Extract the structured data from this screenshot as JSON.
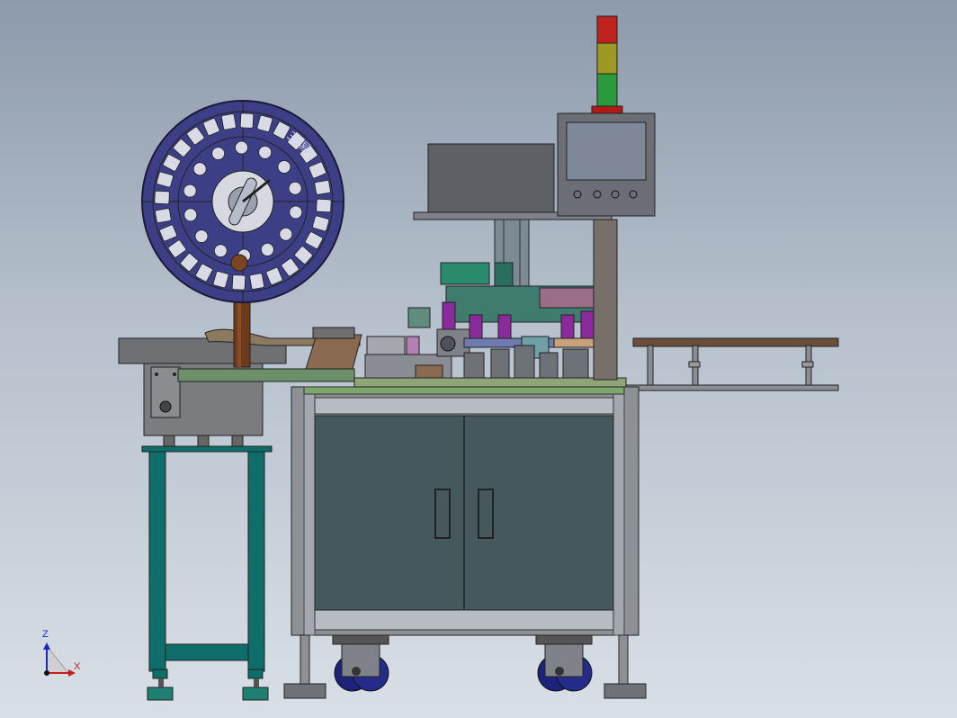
{
  "reel": {
    "text": "三 易"
  },
  "triad": {
    "z_label": "Z",
    "x_label": "X"
  },
  "colors": {
    "background_top": "#8d9aab",
    "reel_face": "#3d3f86",
    "cabinet_panel": "#45595c",
    "stand_frame": "#0f6e6a",
    "hmi_screen": "#7e8898",
    "tower_red": "#c0221e",
    "tower_yellow": "#9c9a22",
    "tower_green": "#2a9a3c",
    "axis_z": "#1a2ac8",
    "axis_x": "#c41e1e"
  }
}
